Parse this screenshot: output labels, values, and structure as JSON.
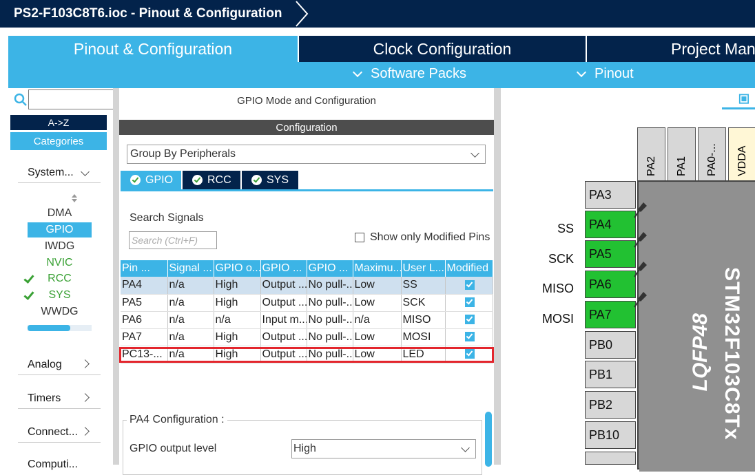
{
  "titlebar": {
    "title": "PS2-F103C8T6.ioc - Pinout & Configuration"
  },
  "tabs": [
    {
      "label": "Pinout & Configuration"
    },
    {
      "label": "Clock Configuration"
    },
    {
      "label": "Project Man"
    }
  ],
  "submenu": {
    "software_packs": "Software Packs",
    "pinout": "Pinout"
  },
  "left": {
    "az": "A->Z",
    "categories": "Categories",
    "system": "System...",
    "system_items": [
      {
        "label": "DMA"
      },
      {
        "label": "GPIO"
      },
      {
        "label": "IWDG"
      },
      {
        "label": "NVIC"
      },
      {
        "label": "RCC"
      },
      {
        "label": "SYS"
      },
      {
        "label": "WWDG"
      }
    ],
    "analog": "Analog",
    "timers": "Timers",
    "connectivity": "Connect...",
    "computing": "Computi..."
  },
  "middle": {
    "header": "GPIO Mode and Configuration",
    "config_bar": "Configuration",
    "group_by": "Group By Peripherals",
    "tabs": [
      "GPIO",
      "RCC",
      "SYS"
    ],
    "search_label": "Search Signals",
    "search_placeholder": "Search (Ctrl+F)",
    "show_modified": "Show only Modified Pins",
    "columns": [
      "Pin ...",
      "Signal ...",
      "GPIO o...",
      "GPIO ...",
      "GPIO ...",
      "Maximu...",
      "User L...",
      "Modified"
    ],
    "rows": [
      [
        "PA4",
        "n/a",
        "High",
        "Output ...",
        "No pull-...",
        "Low",
        "SS"
      ],
      [
        "PA5",
        "n/a",
        "High",
        "Output ...",
        "No pull-...",
        "Low",
        "SCK"
      ],
      [
        "PA6",
        "n/a",
        "n/a",
        "Input m...",
        "No pull-...",
        "n/a",
        "MISO"
      ],
      [
        "PA7",
        "n/a",
        "High",
        "Output ...",
        "No pull-...",
        "Low",
        "MOSI"
      ],
      [
        "PC13-...",
        "n/a",
        "High",
        "Output ...",
        "No pull-...",
        "Low",
        "LED"
      ]
    ],
    "pa4_config_title": "PA4 Configuration :",
    "output_level_label": "GPIO output level",
    "output_level_value": "High"
  },
  "chip": {
    "top_pins": [
      "PA2",
      "PA1",
      "PA0-...",
      "VDDA"
    ],
    "left_pins": [
      {
        "name": "PA3",
        "label": ""
      },
      {
        "name": "PA4",
        "label": "SS"
      },
      {
        "name": "PA5",
        "label": "SCK"
      },
      {
        "name": "PA6",
        "label": "MISO"
      },
      {
        "name": "PA7",
        "label": "MOSI"
      },
      {
        "name": "PB0",
        "label": ""
      },
      {
        "name": "PB1",
        "label": ""
      },
      {
        "name": "PB2",
        "label": ""
      },
      {
        "name": "PB10",
        "label": ""
      }
    ],
    "name": "STM32F103C8Tx",
    "package": "LQFP48"
  },
  "colors": {
    "navy": "#03234b",
    "blue": "#3cb4e6",
    "green": "#22c132",
    "red": "#e3262d"
  }
}
